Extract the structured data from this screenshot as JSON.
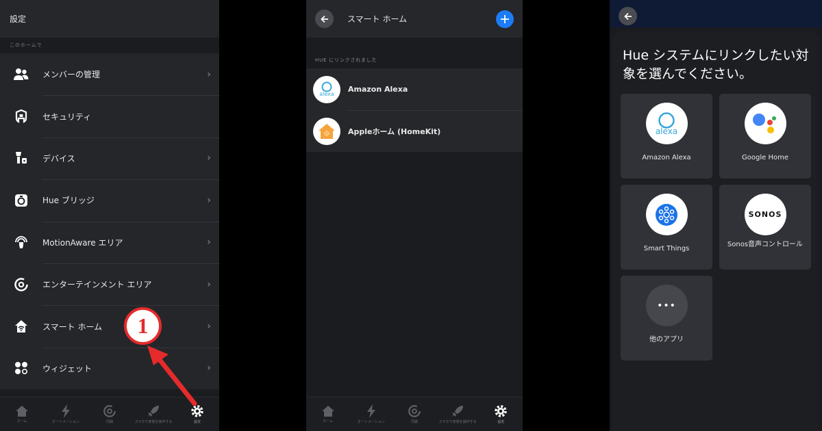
{
  "panel_settings": {
    "title": "設定",
    "section_label": "このホームで",
    "items": [
      {
        "label": "メンバーの管理",
        "icon": "members-icon",
        "chevron": true
      },
      {
        "label": "セキュリティ",
        "icon": "security-icon",
        "chevron": false
      },
      {
        "label": "デバイス",
        "icon": "devices-icon",
        "chevron": true
      },
      {
        "label": "Hue ブリッジ",
        "icon": "bridge-icon",
        "chevron": true
      },
      {
        "label": "MotionAware エリア",
        "icon": "motionaware-icon",
        "chevron": true
      },
      {
        "label": "エンターテインメント エリア",
        "icon": "entertainment-icon",
        "chevron": true
      },
      {
        "label": "スマート ホーム",
        "icon": "smart-home-icon",
        "chevron": true
      },
      {
        "label": "ウィジェット",
        "icon": "widget-icon",
        "chevron": true
      }
    ],
    "chevron_glyph": "›",
    "tabs": [
      {
        "label": "ホーム",
        "icon": "home-icon"
      },
      {
        "label": "オートメーション",
        "icon": "automation-icon"
      },
      {
        "label": "同期",
        "icon": "sync-icon"
      },
      {
        "label": "スマホで家電を操作する",
        "icon": "rocket-icon"
      },
      {
        "label": "設定",
        "icon": "gear-icon",
        "active": true
      }
    ],
    "annotation": "1"
  },
  "panel_smarthome": {
    "title": "スマート ホーム",
    "section_label": "HUE にリンクされました",
    "items": [
      {
        "label": "Amazon Alexa",
        "logo_text": "alexa"
      },
      {
        "label": "Appleホーム (HomeKit)",
        "logo_text": ""
      }
    ],
    "tabs": [
      {
        "label": "ホーム",
        "icon": "home-icon"
      },
      {
        "label": "オートメーション",
        "icon": "automation-icon"
      },
      {
        "label": "同期",
        "icon": "sync-icon"
      },
      {
        "label": "スマホで家電を操作する",
        "icon": "rocket-icon"
      },
      {
        "label": "設定",
        "icon": "gear-icon",
        "active": true
      }
    ]
  },
  "panel_link": {
    "heading": "Hue システムにリンクしたい対象を選んでください。",
    "cards": [
      {
        "label": "Amazon Alexa",
        "logo_text": "alexa"
      },
      {
        "label": "Google Home",
        "logo_text": ""
      },
      {
        "label": "Smart Things",
        "logo_text": ""
      },
      {
        "label": "Sonos音声コントロール",
        "logo_text": "SONOS"
      },
      {
        "label": "他のアプリ",
        "logo_text": "•••"
      }
    ]
  },
  "colors": {
    "accent_blue": "#1c7cf4",
    "annotation_red": "#e52b2b",
    "alexa_blue": "#37a6db",
    "homekit_orange": "#f6a33c",
    "smartthings_blue": "#1a73e8"
  }
}
